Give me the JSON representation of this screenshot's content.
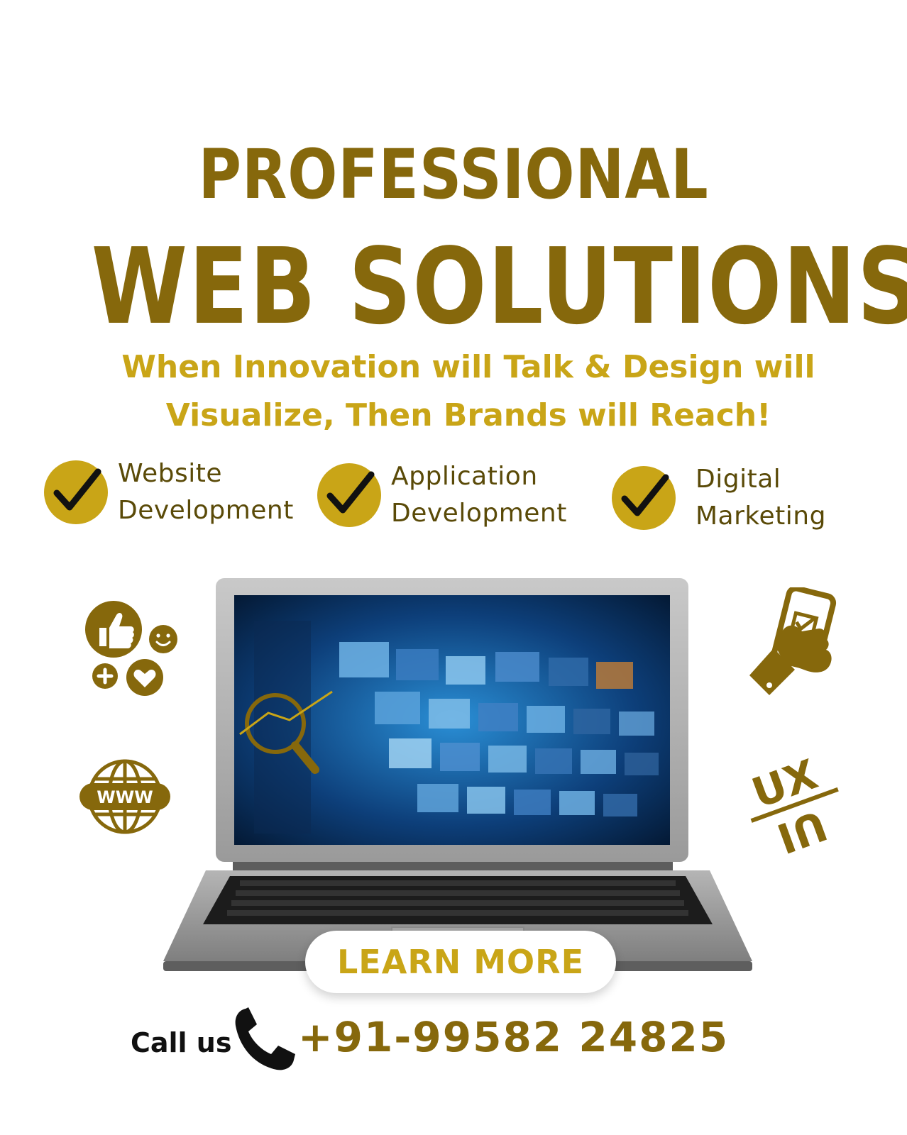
{
  "headline": {
    "line1": "PROFESSIONAL",
    "line2": "WEB SOLUTIONS"
  },
  "tagline": {
    "line1": "When Innovation will Talk & Design will",
    "line2": "Visualize, Then Brands will Reach!"
  },
  "services": [
    {
      "line1": "Website",
      "line2": "Development",
      "icon": "check-icon"
    },
    {
      "line1": "Application",
      "line2": "Development",
      "icon": "check-icon"
    },
    {
      "line1": "Digital",
      "line2": "Marketing",
      "icon": "check-icon"
    }
  ],
  "icons": {
    "social": "social-reactions-icon",
    "www": "www-globe-icon",
    "mobile": "hand-phone-icon",
    "uxui": "ux-ui-icon",
    "uxui_top": "UX",
    "uxui_bottom": "UI",
    "www_text": "WWW"
  },
  "cta": {
    "learn_more": "LEARN MORE"
  },
  "contact": {
    "call_label": "Call us",
    "phone": "+91-99582 24825",
    "phone_icon": "phone-icon"
  },
  "colors": {
    "primary": "#86680c",
    "accent": "#c9a517",
    "text_dark": "#111111"
  }
}
